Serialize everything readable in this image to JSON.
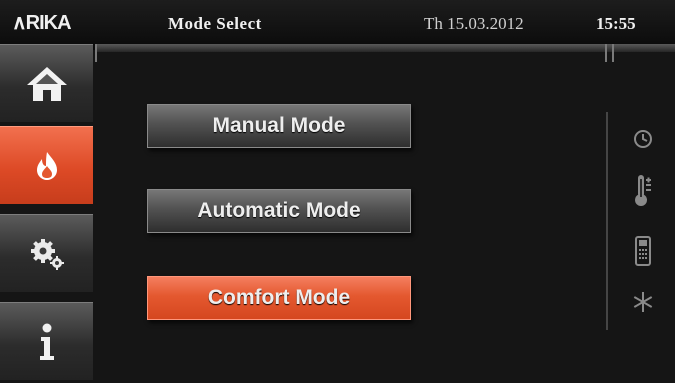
{
  "header": {
    "logo_text": "∧RIKA",
    "title": "Mode Select",
    "date": "Th 15.03.2012",
    "time": "15:55"
  },
  "sidebar": {
    "items": [
      {
        "name": "home",
        "icon": "home-icon",
        "active": false
      },
      {
        "name": "flame",
        "icon": "flame-icon",
        "active": true
      },
      {
        "name": "settings",
        "icon": "gears-icon",
        "active": false
      },
      {
        "name": "info",
        "icon": "info-icon",
        "active": false
      }
    ]
  },
  "modes": [
    {
      "label": "Manual Mode",
      "active": false
    },
    {
      "label": "Automatic Mode",
      "active": false
    },
    {
      "label": "Comfort Mode",
      "active": true
    }
  ],
  "status_icons": [
    "clock-icon",
    "thermometer-icon",
    "remote-icon",
    "snowflake-icon"
  ],
  "colors": {
    "accent": "#e4582f",
    "background": "#151515",
    "button": "#4a4a4a"
  }
}
